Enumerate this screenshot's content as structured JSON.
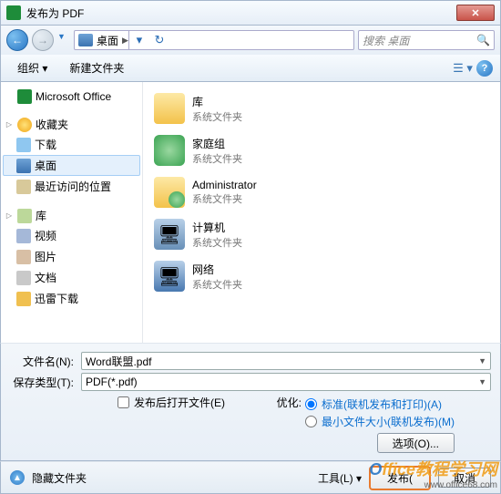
{
  "title": "发布为 PDF",
  "breadcrumb": {
    "location": "桌面"
  },
  "search": {
    "placeholder": "搜索 桌面"
  },
  "toolbar": {
    "organize": "组织",
    "new_folder": "新建文件夹"
  },
  "nav": {
    "ms_office": "Microsoft Office",
    "favorites": "收藏夹",
    "downloads": "下载",
    "desktop": "桌面",
    "recent": "最近访问的位置",
    "libraries": "库",
    "videos": "视频",
    "pictures": "图片",
    "documents": "文档",
    "thunder": "迅雷下载"
  },
  "content": {
    "sysfolder": "系统文件夹",
    "library": "库",
    "homegroup": "家庭组",
    "admin": "Administrator",
    "computer": "计算机",
    "network": "网络"
  },
  "form": {
    "filename_label": "文件名(N):",
    "filename_value": "Word联盟.pdf",
    "savetype_label": "保存类型(T):",
    "savetype_value": "PDF(*.pdf)",
    "open_after": "发布后打开文件(E)",
    "optimize_label": "优化:",
    "opt_standard": "标准(联机发布和打印)(A)",
    "opt_min": "最小文件大小(联机发布)(M)",
    "options_btn": "选项(O)..."
  },
  "actions": {
    "hide_folders": "隐藏文件夹",
    "tools": "工具(L)",
    "publish": "发布(",
    "cancel": "取消"
  },
  "watermark": {
    "brand_prefix": "O",
    "brand_rest": "ffice教程学习网",
    "url": "www.office68.com"
  }
}
